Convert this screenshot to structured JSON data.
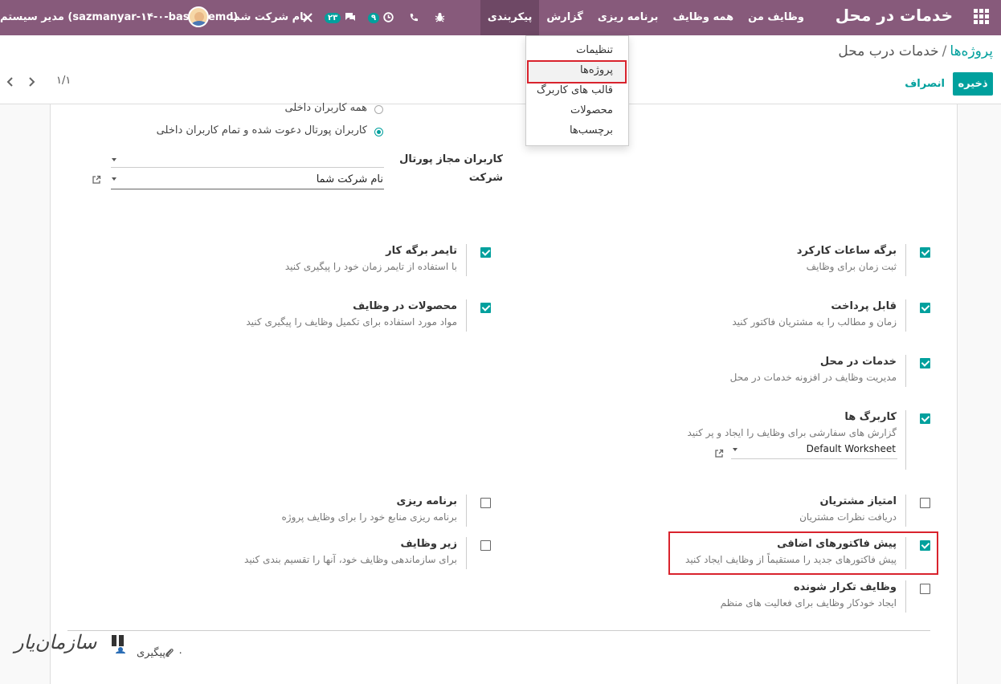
{
  "navbar": {
    "app_title": "خدمات در محل",
    "menu": [
      "وظایف من",
      "همه وظایف",
      "برنامه ریزی",
      "گزارش",
      "پیکربندی"
    ],
    "active_menu": "پیکربندی",
    "company": "نام شرکت شما",
    "activity_count": "۹",
    "messages_count": "۲۳",
    "user": "مدیر سیستم (sazmanyar-۱۴-۰-base-demo)"
  },
  "dropdown": {
    "items": [
      "تنظیمات",
      "پروژه‌ها",
      "قالب های کاربرگ",
      "محصولات",
      "برچسب‌ها"
    ],
    "highlighted": "پروژه‌ها"
  },
  "breadcrumb": {
    "parent": "پروژه‌ها",
    "separator": "/",
    "current": "خدمات درب محل"
  },
  "buttons": {
    "save": "ذخیره",
    "discard": "انصراف"
  },
  "pager": {
    "value": "۱/۱"
  },
  "visibility": {
    "option_all_internal": "همه کاربران داخلی",
    "option_portal": "کاربران پورتال دعوت شده و تمام کاربران داخلی",
    "selected": "option_portal"
  },
  "fields": {
    "portal_users_label": "کاربران مجاز پورتال",
    "portal_users_value": "",
    "company_label": "شرکت",
    "company_value": "نام شرکت شما"
  },
  "settings_right": [
    {
      "title": "برگه ساعات کارکرد",
      "desc": "ثبت زمان برای وظایف",
      "checked": true
    },
    {
      "title": "قابل پرداخت",
      "desc": "زمان و مطالب را به مشتریان فاکتور کنید",
      "checked": true
    },
    {
      "title": "خدمات در محل",
      "desc": "مدیریت وظایف در افزونه خدمات در محل",
      "checked": true
    },
    {
      "title": "کاربرگ ها",
      "desc": "گزارش های سفارشی برای وظایف را ایجاد و پر کنید",
      "checked": true,
      "select": "Default Worksheet"
    },
    {
      "title": "امتیاز مشتریان",
      "desc": "دریافت نظرات مشتریان",
      "checked": false
    },
    {
      "title": "پیش فاکتورهای اضافی",
      "desc": "پیش فاکتورهای جدید را مستقیماً از وظایف ایجاد کنید",
      "checked": true
    },
    {
      "title": "وظایف تکرار شونده",
      "desc": "ایجاد خودکار وظایف برای فعالیت های منظم",
      "checked": false
    }
  ],
  "settings_left": [
    {
      "title": "تایمر برگه کار",
      "desc": "با استفاده از تایمر زمان خود را پیگیری کنید",
      "checked": true
    },
    {
      "title": "محصولات در وظایف",
      "desc": "مواد مورد استفاده برای تکمیل وظایف را پیگیری کنید",
      "checked": true
    },
    {
      "title": "برنامه ریزی",
      "desc": "برنامه ریزی منابع خود را برای وظایف پروژه",
      "checked": false
    },
    {
      "title": "زیر وظایف",
      "desc": "برای سازماندهی وظایف خود، آنها را تقسیم بندی کنید",
      "checked": false
    }
  ],
  "chatter": {
    "follow": "پیگیری",
    "attachments": "۰"
  },
  "watermark": "سازمان‌یار"
}
